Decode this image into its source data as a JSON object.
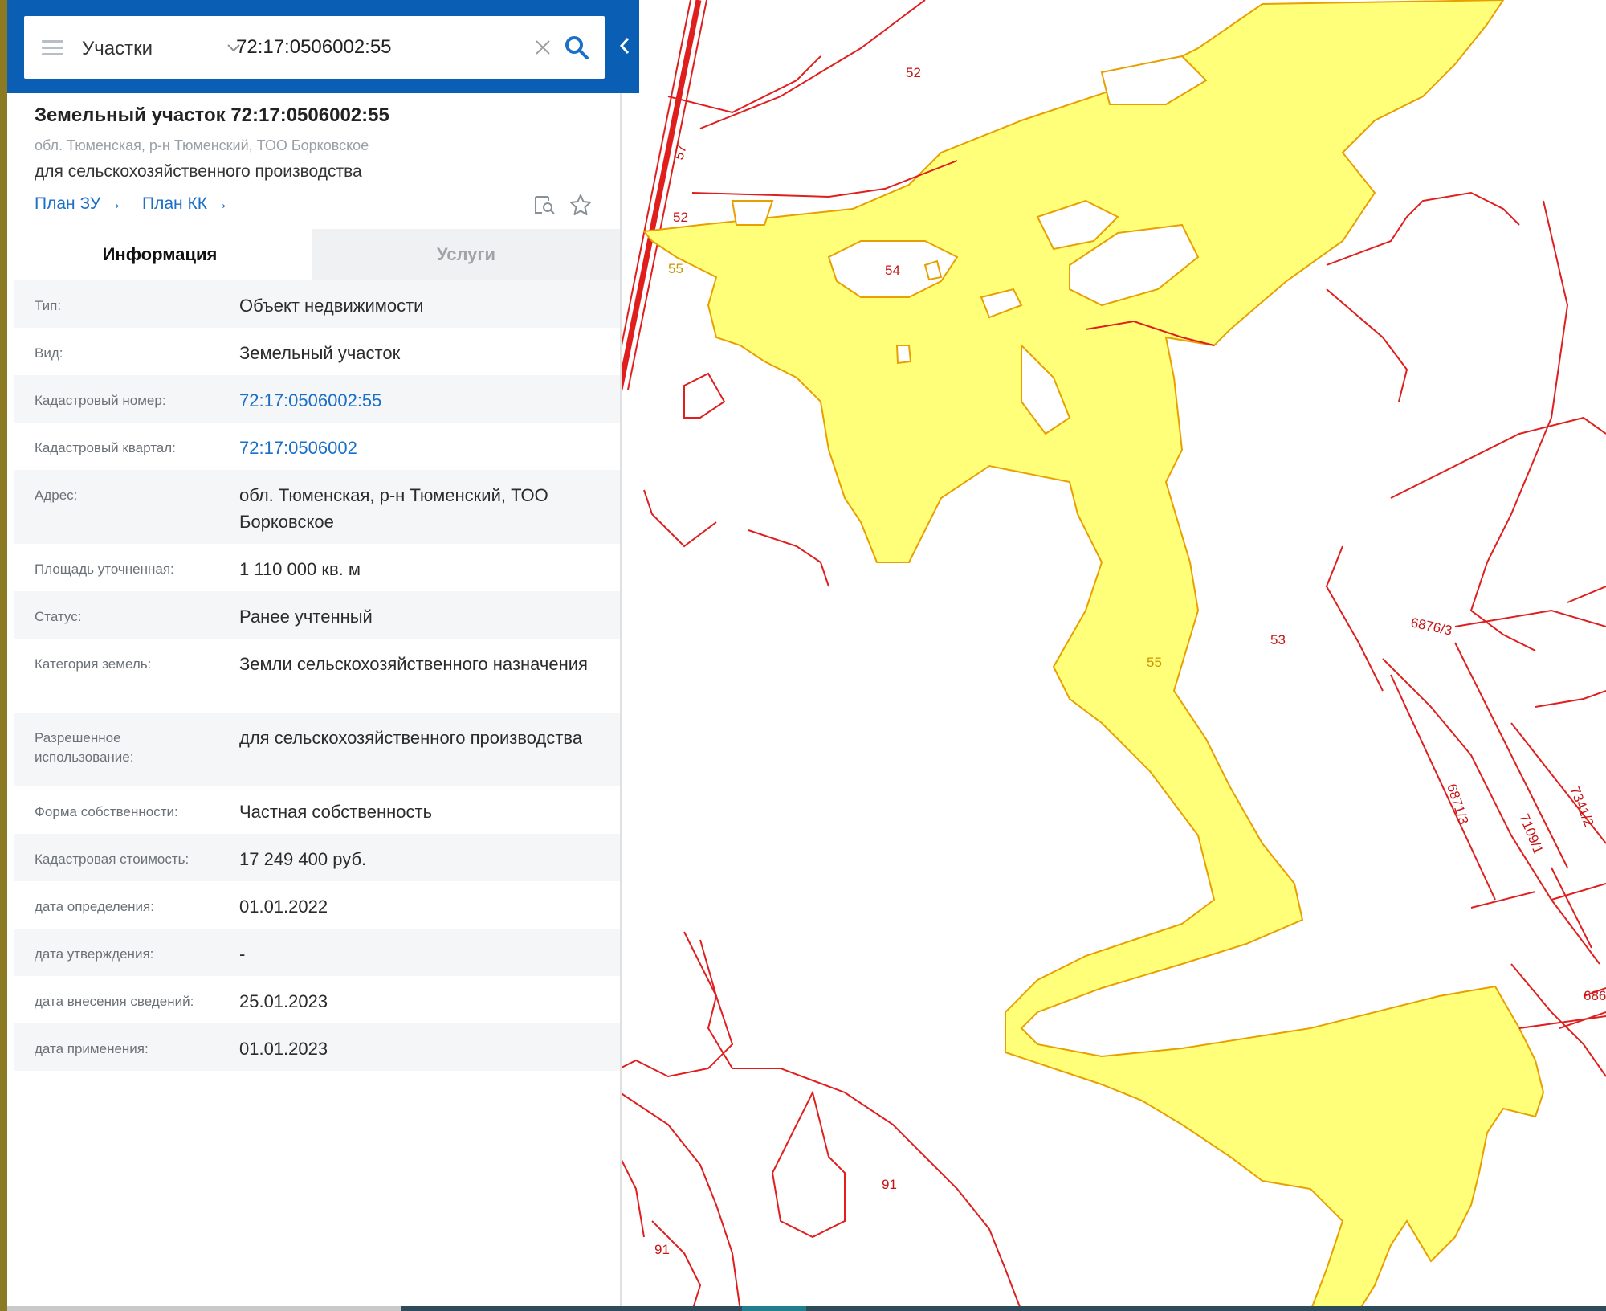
{
  "search": {
    "layer": "Участки",
    "query": "72:17:0506002:55"
  },
  "parcel": {
    "title": "Земельный участок 72:17:0506002:55",
    "address": "обл. Тюменская, р-н Тюменский, ТОО Борковское",
    "use": "для сельскохозяйственного производства",
    "links": {
      "plan_zu": "План ЗУ →",
      "plan_kk": "План КК →"
    }
  },
  "tabs": {
    "info": "Информация",
    "services": "Услуги"
  },
  "info": [
    {
      "label": "Тип:",
      "value": "Объект недвижимости"
    },
    {
      "label": "Вид:",
      "value": "Земельный участок"
    },
    {
      "label": "Кадастровый номер:",
      "value": "72:17:0506002:55"
    },
    {
      "label": "Кадастровый квартал:",
      "value": "72:17:0506002"
    },
    {
      "label": "Адрес:",
      "value": "обл. Тюменская, р-н Тюменский, ТОО Борковское"
    },
    {
      "label": "Площадь уточненная:",
      "value": "1 110 000 кв. м"
    },
    {
      "label": "Статус:",
      "value": "Ранее учтенный"
    },
    {
      "label": "Категория земель:",
      "value": "Земли сельскохозяйственного назначения"
    },
    {
      "label": "Разрешенное использование:",
      "value": "для сельскохозяйственного производства"
    },
    {
      "label": "Форма собственности:",
      "value": "Частная собственность"
    },
    {
      "label": "Кадастровая стоимость:",
      "value": "17 249 400 руб."
    },
    {
      "label": "дата определения:",
      "value": "01.01.2022"
    },
    {
      "label": "дата утверждения:",
      "value": "-"
    },
    {
      "label": "дата внесения сведений:",
      "value": "25.01.2023"
    },
    {
      "label": "дата применения:",
      "value": "01.01.2023"
    }
  ],
  "map": {
    "labels": [
      "52",
      "52",
      "57",
      "55",
      "54",
      "55",
      "53",
      "6876/3",
      "6871/3",
      "7109/1",
      "7341/2",
      "686",
      "91",
      "91"
    ],
    "colors": {
      "parcel_fill": "#ffff7a",
      "parcel_border": "#e8a000",
      "boundary": "#e01e1e",
      "label": "#c81414",
      "selected_label": "#c89600"
    }
  },
  "colors": {
    "header": "#0a5fb4",
    "link": "#1a6fc8"
  },
  "icons": [
    "menu-icon",
    "chevron-down-icon",
    "clear-icon",
    "search-icon",
    "collapse-icon",
    "find-on-map-icon",
    "star-icon"
  ]
}
